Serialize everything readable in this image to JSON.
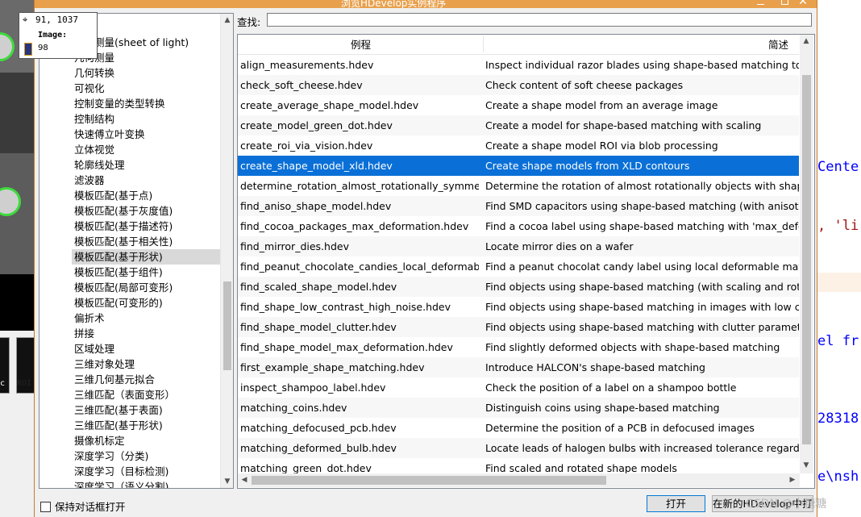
{
  "window": {
    "title": "浏览HDevelop实例程序",
    "close_glyph": "✕"
  },
  "search": {
    "label": "查找:",
    "value": ""
  },
  "tree": {
    "items": [
      "三角测量(sheet of light)",
      "几何测量",
      "几何转换",
      "可视化",
      "控制变量的类型转换",
      "控制结构",
      "快速傅立叶变换",
      "立体视觉",
      "轮廓线处理",
      "滤波器",
      "模板匹配(基于点)",
      "模板匹配(基于灰度值)",
      "模板匹配(基于描述符)",
      "模板匹配(基于相关性)",
      "模板匹配(基于形状)",
      "模板匹配(基于组件)",
      "模板匹配(局部可变形)",
      "模板匹配(可变形的)",
      "偏折术",
      "拼接",
      "区域处理",
      "三维对象处理",
      "三维几何基元拟合",
      "三维匹配（表面变形）",
      "三维匹配(基于表面)",
      "三维匹配(基于形状)",
      "摄像机标定",
      "深度学习（分类)",
      "深度学习（目标检测)",
      "深度学习（语义分割)"
    ],
    "selected_index": 14
  },
  "table": {
    "columns": [
      "例程",
      "简述"
    ],
    "selected_index": 5,
    "rows": [
      [
        "align_measurements.hdev",
        "Inspect individual razor blades using shape-based matching to align"
      ],
      [
        "check_soft_cheese.hdev",
        "Check content of soft cheese packages"
      ],
      [
        "create_average_shape_model.hdev",
        "Create a shape model from an average image"
      ],
      [
        "create_model_green_dot.hdev",
        "Create a model for shape-based matching with scaling"
      ],
      [
        "create_roi_via_vision.hdev",
        "Create a shape model ROI via blob processing"
      ],
      [
        "create_shape_model_xld.hdev",
        "Create shape models from XLD contours"
      ],
      [
        "determine_rotation_almost_rotationally_symmetri...",
        "Determine the rotation of almost rotationally objects with shape-ba"
      ],
      [
        "find_aniso_shape_model.hdev",
        "Find SMD capacitors using shape-based matching (with anisotropic"
      ],
      [
        "find_cocoa_packages_max_deformation.hdev",
        "Find a cocoa label using shape-based matching with 'max_deforma"
      ],
      [
        "find_mirror_dies.hdev",
        "Locate mirror dies on a wafer"
      ],
      [
        "find_peanut_chocolate_candies_local_deformable....",
        "Find a peanut chocolat candy label using local deformable matchin"
      ],
      [
        "find_scaled_shape_model.hdev",
        "Find objects using shape-based matching (with scaling and rotation"
      ],
      [
        "find_shape_low_contrast_high_noise.hdev",
        "Find objects using shape-based matching in images with low contra"
      ],
      [
        "find_shape_model_clutter.hdev",
        "Find objects using shape-based matching with clutter parameters"
      ],
      [
        "find_shape_model_max_deformation.hdev",
        "Find slightly deformed objects with shape-based matching"
      ],
      [
        "first_example_shape_matching.hdev",
        "Introduce HALCON's shape-based matching"
      ],
      [
        "inspect_shampoo_label.hdev",
        "Check the position of a label on a shampoo bottle"
      ],
      [
        "matching_coins.hdev",
        "Distinguish coins using shape-based matching"
      ],
      [
        "matching_defocused_pcb.hdev",
        "Determine the position of a PCB in defocused images"
      ],
      [
        "matching_deformed_bulb.hdev",
        "Locate leads of halogen bulbs with increased tolerance regarding d"
      ],
      [
        "matching_green_dot.hdev",
        "Find scaled and rotated shape models"
      ]
    ]
  },
  "footer": {
    "keep_open_label": "保持对话框打开",
    "open_button": "打开",
    "open_new_button": "在新的HDevelop中打开"
  },
  "tooltip": {
    "coords": "91, 1037",
    "label": "Image:",
    "value": "98"
  },
  "background_code": {
    "lines": [
      {
        "text": "Cente",
        "color": "#0000ff"
      },
      {
        "text": ", 'li",
        "color": "#a31515"
      },
      {
        "text": "el fr",
        "color": "#0000ff"
      },
      {
        "text": "28318",
        "color": "#0000ff"
      },
      {
        "text": "e\\nsh",
        "color": "#0000ff"
      }
    ]
  },
  "background_thumbs": [
    "c",
    "ROI"
  ],
  "watermark": "CSDN @小糖糖"
}
